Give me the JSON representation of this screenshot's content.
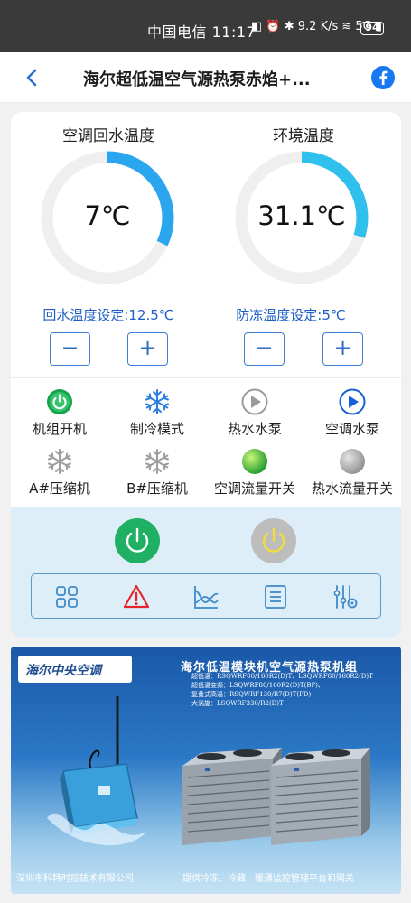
{
  "status_bar": {
    "carrier_time": "中国电信 11:17",
    "icons_text": "◧ ⏰ ✱ 9.2 K/s ≋ 5G ▮",
    "battery": "94"
  },
  "nav": {
    "title": "海尔超低温空气源热泵赤焰+...",
    "back_icon": "chevron-left-icon",
    "share_icon": "facebook-icon"
  },
  "gauges": [
    {
      "label": "空调回水温度",
      "value": "7℃",
      "fill_fraction": 0.32,
      "color": "#2aa6ee"
    },
    {
      "label": "环境温度",
      "value": "31.1℃",
      "fill_fraction": 0.3,
      "color": "#2fc0ee"
    }
  ],
  "setpoints": [
    {
      "label": "回水温度设定:12.5℃",
      "minus": "−",
      "plus": "+"
    },
    {
      "label": "防冻温度设定:5℃",
      "minus": "−",
      "plus": "+"
    }
  ],
  "status_items": [
    {
      "label": "机组开机",
      "icon": "power-on-icon",
      "state": "on"
    },
    {
      "label": "制冷模式",
      "icon": "snowflake-icon",
      "state": "on"
    },
    {
      "label": "热水水泵",
      "icon": "play-grey-icon",
      "state": "off"
    },
    {
      "label": "空调水泵",
      "icon": "play-blue-icon",
      "state": "on"
    },
    {
      "label": "A#压缩机",
      "icon": "snowflake-grey-icon",
      "state": "off"
    },
    {
      "label": "B#压缩机",
      "icon": "snowflake-grey-icon",
      "state": "off"
    },
    {
      "label": "空调流量开关",
      "icon": "green-dot-icon",
      "state": "on"
    },
    {
      "label": "热水流量开关",
      "icon": "grey-dot-icon",
      "state": "off"
    }
  ],
  "controls": {
    "power_on_color": "#1fb064",
    "power_off_color": "#bdbdbd",
    "toolbar": [
      "grid-icon",
      "alarm-icon",
      "chart-icon",
      "list-icon",
      "settings-sliders-icon"
    ]
  },
  "banner": {
    "logo": "海尔中央空调",
    "title": "海尔低温模块机空气源热泵机组",
    "models": [
      "超低温：RSQWRF80/160R2(D)T、LSQWRF80/160R2(D)T",
      "超低温变频：LSQWRF80/160R2(D)T(BP)、",
      "复叠式高温：RSQWRF130/R7(D)T(FD)",
      "大涡旋：LSQWRF330/R2(D)T"
    ],
    "company": "深圳市科特时控技术有限公司",
    "slogan": "提供冷冻、冷藏、暖通监控管理平台和网关"
  }
}
